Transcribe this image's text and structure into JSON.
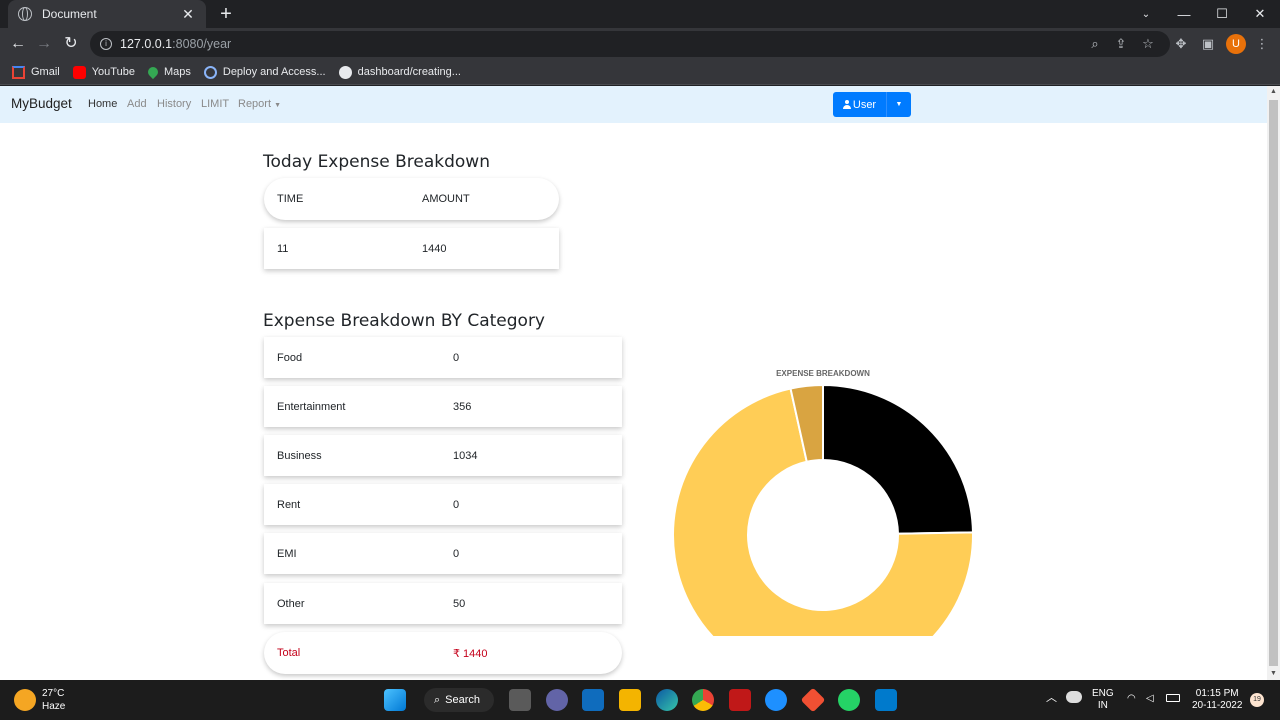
{
  "browser": {
    "tab_title": "Document",
    "url_host": "127.0.0.1",
    "url_path": ":8080/year",
    "profile_initial": "U",
    "bookmarks": [
      "Gmail",
      "YouTube",
      "Maps",
      "Deploy and Access...",
      "dashboard/creating..."
    ]
  },
  "nav": {
    "brand": "MyBudget",
    "links": [
      "Home",
      "Add",
      "History",
      "LIMIT",
      "Report"
    ],
    "user_button": "User"
  },
  "today": {
    "heading": "Today Expense Breakdown",
    "col_time": "TIME",
    "col_amount": "AMOUNT",
    "time": "11",
    "amount": "1440"
  },
  "category": {
    "heading": "Expense Breakdown BY Category",
    "rows": [
      {
        "label": "Food",
        "value": "0"
      },
      {
        "label": "Entertainment",
        "value": "356"
      },
      {
        "label": "Business",
        "value": "1034"
      },
      {
        "label": "Rent",
        "value": "0"
      },
      {
        "label": "EMI",
        "value": "0"
      },
      {
        "label": "Other",
        "value": "50"
      }
    ],
    "total_label": "Total",
    "total_value": "₹ 1440"
  },
  "chart_data": {
    "type": "pie",
    "title": "EXPENSE BREAKDOWN",
    "categories": [
      "Food",
      "Entertainment",
      "Business",
      "Rent",
      "EMI",
      "Other"
    ],
    "values": [
      0,
      356,
      1034,
      0,
      0,
      50
    ],
    "colors": [
      "#ff6384",
      "#000000",
      "#ffcd56",
      "#c9cbcf",
      "#36a2eb",
      "#d9a441"
    ],
    "donut": true,
    "legend_position": "bottom"
  },
  "taskbar": {
    "temperature": "27°C",
    "weather": "Haze",
    "search": "Search",
    "lang1": "ENG",
    "lang2": "IN",
    "time": "01:15 PM",
    "date": "20-11-2022",
    "notifications": "19"
  }
}
